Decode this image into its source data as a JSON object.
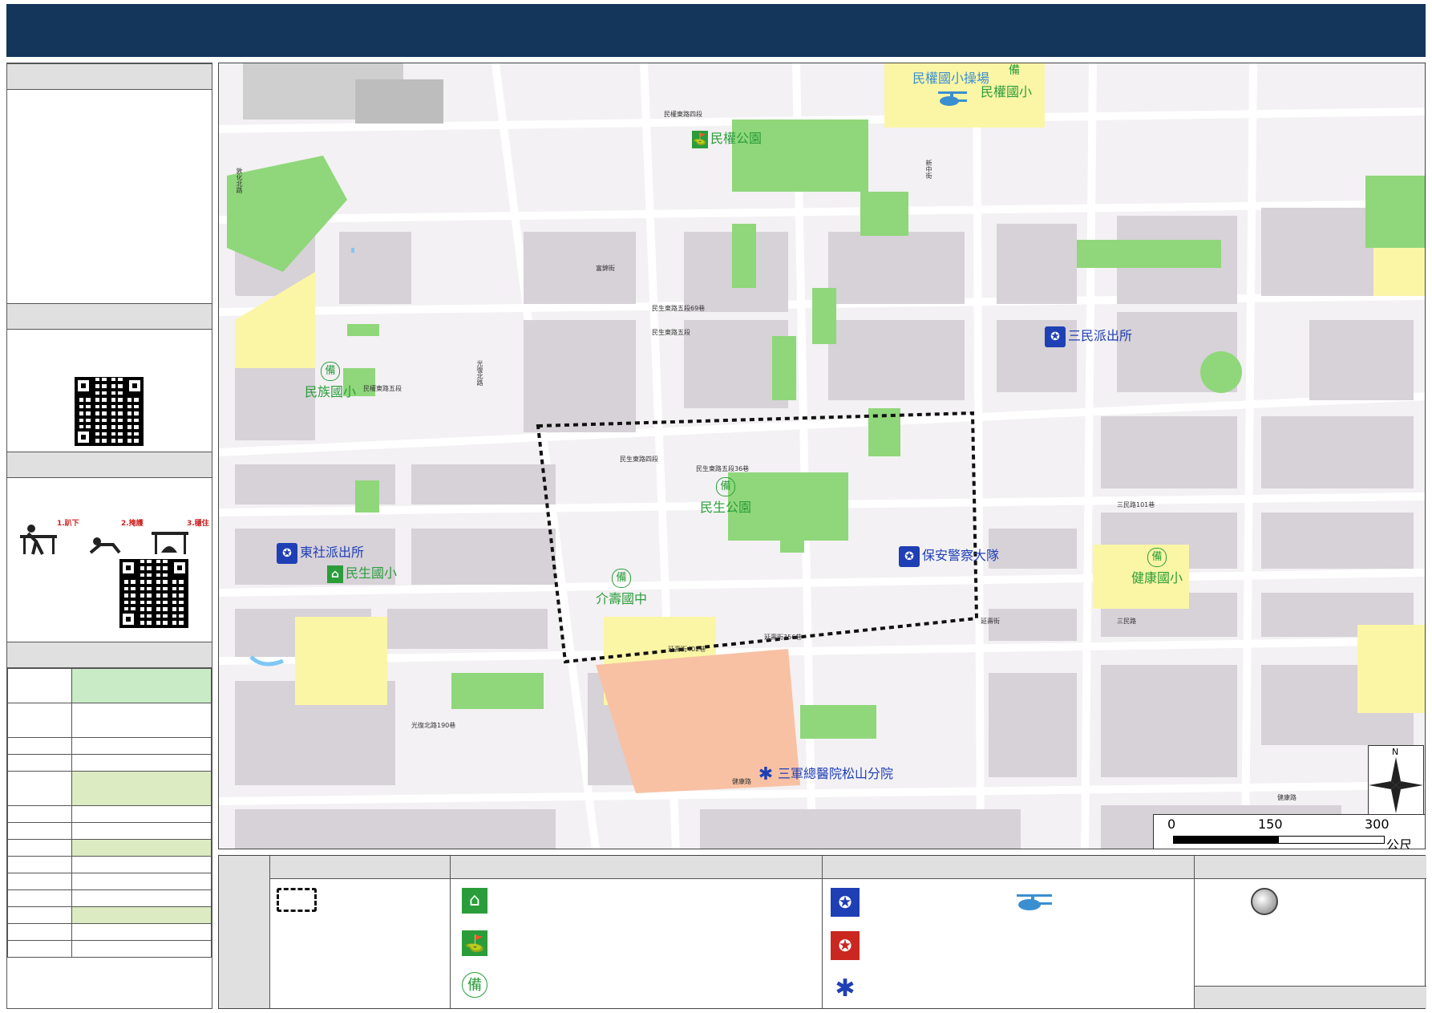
{
  "header": {
    "title": ""
  },
  "left_panel": {
    "section_titles": [
      "",
      "",
      "",
      ""
    ],
    "shelter_rows": [
      {
        "name": "",
        "value": ""
      },
      {
        "name": "",
        "value": ""
      },
      {
        "name": "",
        "value": ""
      },
      {
        "name": "",
        "value": ""
      },
      {
        "name": "",
        "value": ""
      },
      {
        "name": "",
        "value": ""
      },
      {
        "name": "",
        "value": ""
      },
      {
        "name": "",
        "value": ""
      },
      {
        "name": "",
        "value": ""
      },
      {
        "name": "",
        "value": ""
      },
      {
        "name": "",
        "value": ""
      },
      {
        "name": "",
        "value": ""
      },
      {
        "name": "",
        "value": ""
      },
      {
        "name": "",
        "value": ""
      }
    ],
    "drill_steps": [
      "1.趴下",
      "2.掩護",
      "3.穩住"
    ]
  },
  "map": {
    "places": {
      "minquan_school_field": "民權國小操場",
      "minquan_school": "民權國小",
      "minquan_park": "民權公園",
      "minzu_school": "民族國小",
      "sanmin_police": "三民派出所",
      "minsheng_park": "民生公園",
      "jieshou_middle": "介壽國中",
      "dongshe_police": "東社派出所",
      "minsheng_school": "民生國小",
      "baoan_police": "保安警察大隊",
      "jiankang_school": "健康國小",
      "tri_service_hospital": "三軍總醫院松山分院"
    },
    "backup_glyph": "備",
    "roads": [
      "民權東路四段",
      "民權東路五段",
      "民生東路四段",
      "民生東路五段",
      "民生東路五段69巷",
      "延壽街",
      "三民路",
      "健康路",
      "光復北路",
      "敦化北路",
      "富錦街",
      "新中街",
      "民生東路五段36巷",
      "延壽街402巷",
      "延壽街356巷",
      "光復北路190巷",
      "健康路",
      "三民路101巷"
    ],
    "scale": {
      "ticks": [
        "0",
        "150",
        "300"
      ],
      "unit": "公尺"
    },
    "north": "N"
  },
  "legend": {
    "column_titles": [
      "",
      "",
      "",
      "",
      ""
    ],
    "footer": ""
  },
  "colors": {
    "header": "#14365a",
    "park": "#8fd77a",
    "school": "#fbf6a6",
    "hospital": "#f8c1a3",
    "block": "#d6cfd6",
    "police": "#1f3fb5",
    "green_text": "#2a9d3a"
  }
}
